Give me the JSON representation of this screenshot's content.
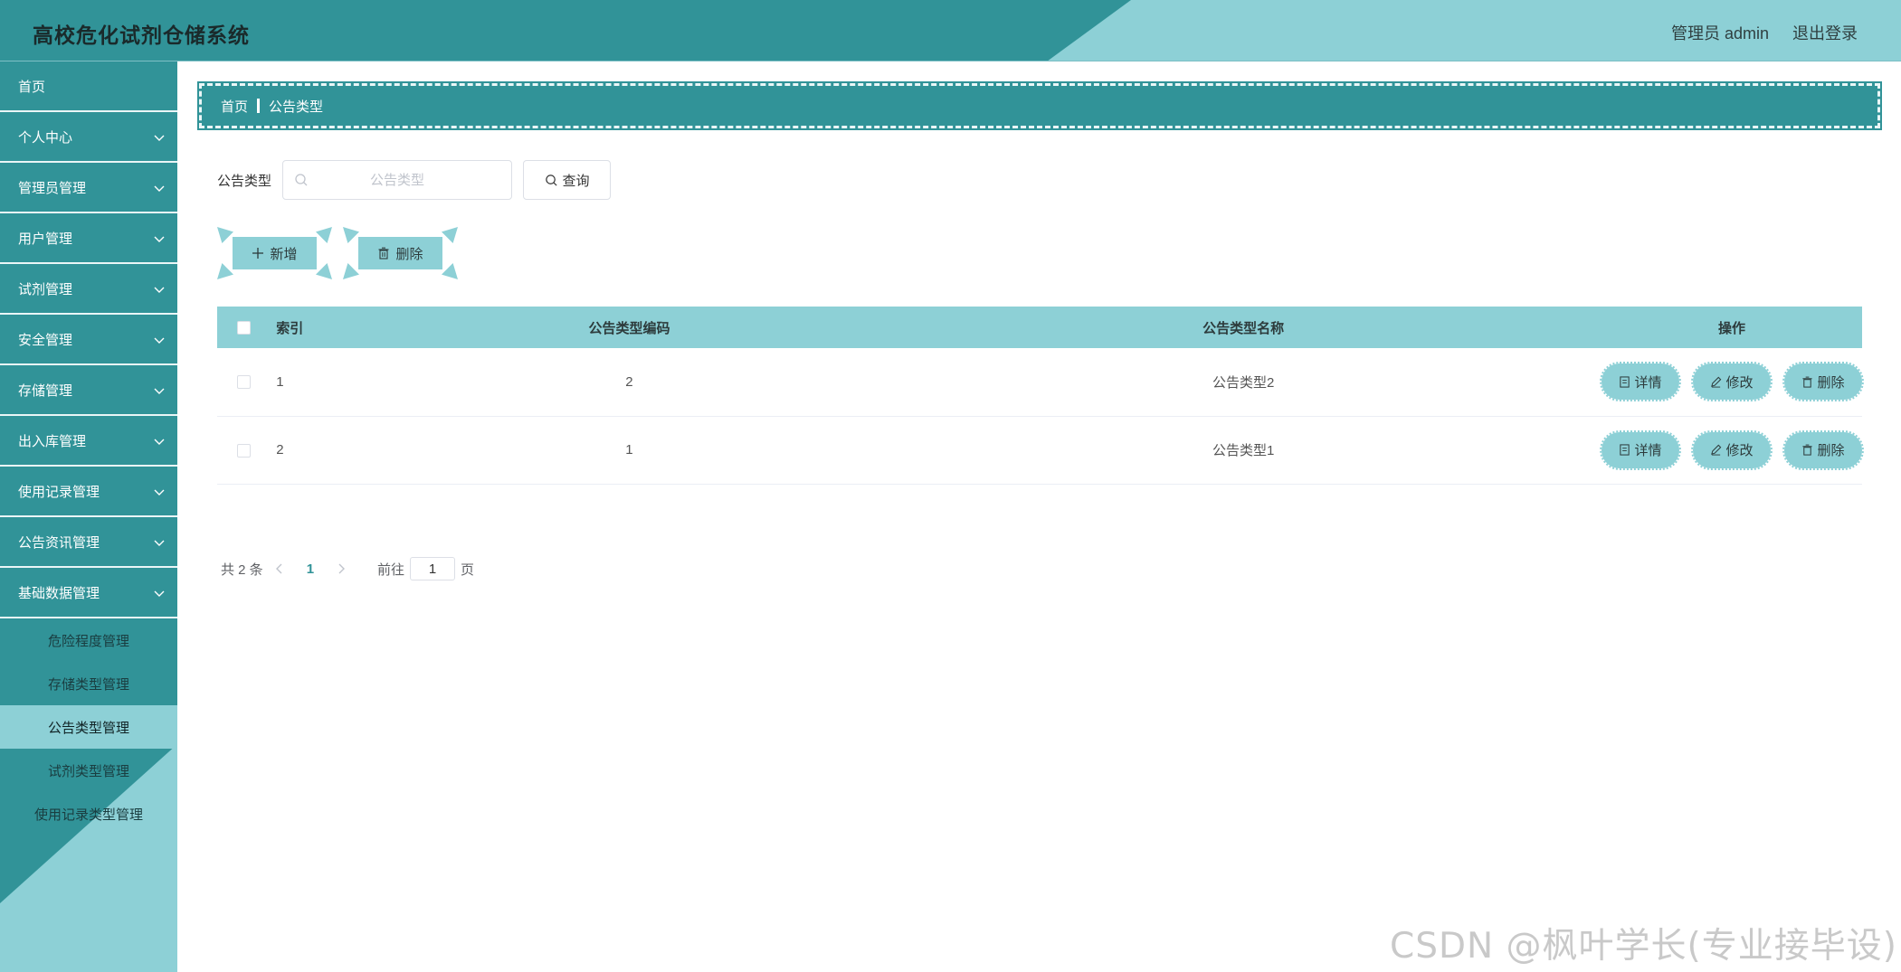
{
  "header": {
    "title": "高校危化试剂仓储系统",
    "user_label": "管理员 admin",
    "logout_label": "退出登录"
  },
  "sidebar": {
    "items": [
      {
        "label": "首页",
        "has_children": false
      },
      {
        "label": "个人中心",
        "has_children": true
      },
      {
        "label": "管理员管理",
        "has_children": true
      },
      {
        "label": "用户管理",
        "has_children": true
      },
      {
        "label": "试剂管理",
        "has_children": true
      },
      {
        "label": "安全管理",
        "has_children": true
      },
      {
        "label": "存储管理",
        "has_children": true
      },
      {
        "label": "出入库管理",
        "has_children": true
      },
      {
        "label": "使用记录管理",
        "has_children": true
      },
      {
        "label": "公告资讯管理",
        "has_children": true
      },
      {
        "label": "基础数据管理",
        "has_children": true,
        "expanded": true
      }
    ],
    "subitems": [
      {
        "label": "危险程度管理"
      },
      {
        "label": "存储类型管理"
      },
      {
        "label": "公告类型管理",
        "active": true
      },
      {
        "label": "试剂类型管理"
      },
      {
        "label": "使用记录类型管理"
      }
    ]
  },
  "breadcrumb": {
    "home": "首页",
    "current": "公告类型"
  },
  "search": {
    "label": "公告类型",
    "placeholder": "公告类型",
    "value": "",
    "query_label": "查询"
  },
  "actions": {
    "add_label": "新增",
    "delete_label": "删除"
  },
  "table": {
    "headers": {
      "index": "索引",
      "code": "公告类型编码",
      "name": "公告类型名称",
      "ops": "操作"
    },
    "rows": [
      {
        "index": "1",
        "code": "2",
        "name": "公告类型2"
      },
      {
        "index": "2",
        "code": "1",
        "name": "公告类型1"
      }
    ],
    "op_labels": {
      "detail": "详情",
      "edit": "修改",
      "delete": "删除"
    }
  },
  "pagination": {
    "total_text": "共 2 条",
    "current_page": "1",
    "goto_prefix": "前往",
    "goto_value": "1",
    "goto_suffix": "页"
  },
  "watermark": "CSDN @枫叶学长(专业接毕设)",
  "colors": {
    "primary": "#319398",
    "accent": "#8dd0d6",
    "divider": "#eaf6f7"
  }
}
